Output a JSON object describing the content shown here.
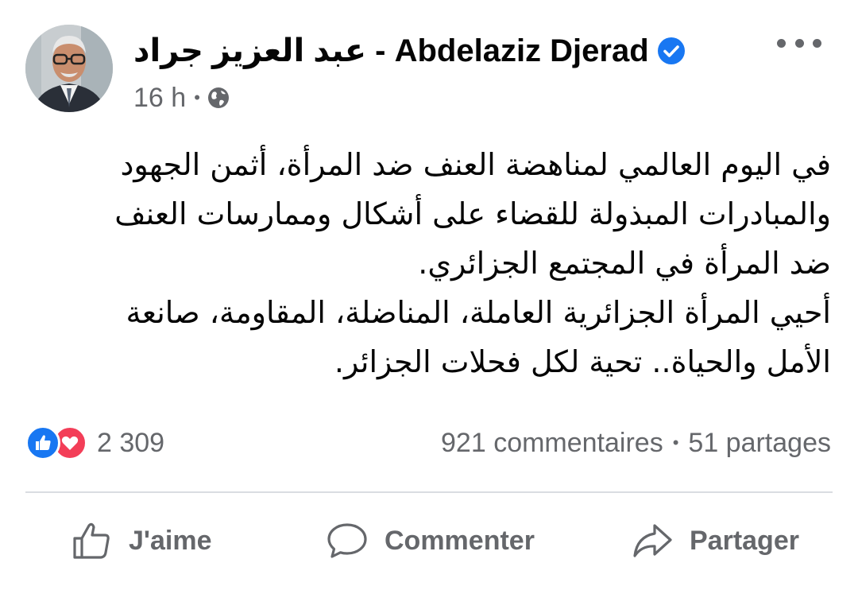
{
  "post": {
    "author": "عبد العزيز جراد - Abdelaziz Djerad",
    "time": "16 h",
    "separator": "•",
    "paragraphs": [
      "في اليوم العالمي لمناهضة العنف ضد المرأة، أثمن الجهود والمبادرات المبذولة للقضاء على أشكال وممارسات العنف ضد المرأة في المجتمع الجزائري.",
      "أحيي المرأة الجزائرية العاملة، المناضلة، المقاومة، صانعة الأمل والحياة.. تحية لكل فحلات الجزائر."
    ]
  },
  "engagement": {
    "reaction_count": "2 309",
    "comments": "921 commentaires",
    "separator": "•",
    "shares": "51 partages"
  },
  "actions": {
    "like": "J'aime",
    "comment": "Commenter",
    "share": "Partager"
  },
  "icons": {
    "verified": "verified-badge-icon",
    "globe": "globe-icon",
    "more": "more-options-icon",
    "like_reaction": "like-reaction-icon",
    "love_reaction": "love-reaction-icon"
  },
  "colors": {
    "accent": "#1877f2",
    "love": "#f33e58",
    "secondary_text": "#65676b",
    "divider": "#dadde1"
  }
}
